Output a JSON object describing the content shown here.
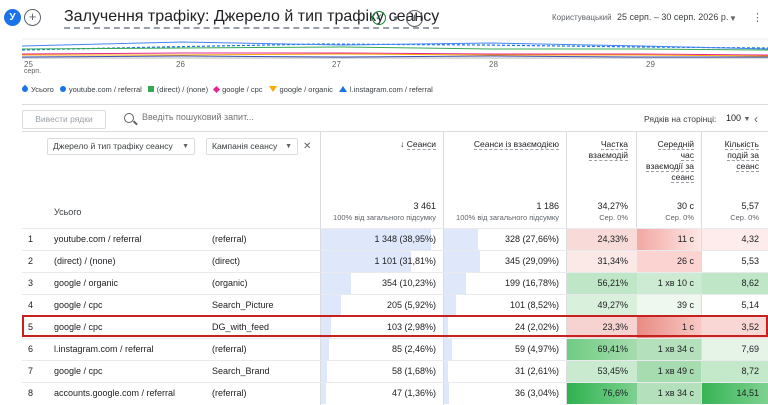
{
  "header": {
    "avatar_letter": "У",
    "title": "Залучення трафіку: Джерело й тип трафіку сеансу",
    "custom_label": "Користувацький",
    "date_range": "25 серп. – 30 серп. 2026 р."
  },
  "chart": {
    "x_ticks": [
      "25",
      "26",
      "27",
      "28",
      "29"
    ],
    "x_sub": "серп.",
    "legend": [
      {
        "label": "Усього",
        "color": "#1a73e8",
        "marker": "drop"
      },
      {
        "label": "youtube.com / referral",
        "color": "#1a73e8",
        "marker": "circle"
      },
      {
        "label": "(direct) / (none)",
        "color": "#34a853",
        "marker": "square"
      },
      {
        "label": "google / cpc",
        "color": "#e52592",
        "marker": "diamond"
      },
      {
        "label": "google / organic",
        "color": "#f9ab00",
        "marker": "triangle-down"
      },
      {
        "label": "l.instagram.com / referral",
        "color": "#1a73e8",
        "marker": "triangle-up"
      }
    ]
  },
  "toolbar": {
    "rows_button": "Вивести рядки",
    "search_placeholder": "Введіть пошуковий запит...",
    "rows_per_page_label": "Рядків на сторінці:",
    "rows_per_page_value": "100"
  },
  "table": {
    "dim1": "Джерело й тип трафіку сеансу",
    "dim2": "Кампанія сеансу",
    "metrics": [
      {
        "label": "Сеанси",
        "sorted": true
      },
      {
        "label": "Сеанси із взаємодією"
      },
      {
        "label": "Частка взаємодій"
      },
      {
        "label": "Середній час взаємодії за сеанс"
      },
      {
        "label": "Кількість подій за сеанс"
      }
    ],
    "totals": {
      "label": "Усього",
      "values": [
        "3 461",
        "1 186",
        "34,27%",
        "30 с",
        "5,57"
      ],
      "subs": [
        "100% від загального підсумку",
        "100% від загального підсумку",
        "Сер. 0%",
        "Сер. 0%",
        "Сер. 0%"
      ]
    },
    "rows": [
      {
        "n": "1",
        "source": "youtube.com / referral",
        "campaign": "(referral)",
        "sessions": "1 348 (38,95%)",
        "engaged": "328 (27,66%)",
        "rate": "24,33%",
        "time": "11 с",
        "events": "4,32"
      },
      {
        "n": "2",
        "source": "(direct) / (none)",
        "campaign": "(direct)",
        "sessions": "1 101 (31,81%)",
        "engaged": "345 (29,09%)",
        "rate": "31,34%",
        "time": "26 с",
        "events": "5,53"
      },
      {
        "n": "3",
        "source": "google / organic",
        "campaign": "(organic)",
        "sessions": "354 (10,23%)",
        "engaged": "199 (16,78%)",
        "rate": "56,21%",
        "time": "1 хв 10 с",
        "events": "8,62"
      },
      {
        "n": "4",
        "source": "google / cpc",
        "campaign": "Search_Picture",
        "sessions": "205 (5,92%)",
        "engaged": "101 (8,52%)",
        "rate": "49,27%",
        "time": "39 с",
        "events": "5,14"
      },
      {
        "n": "5",
        "source": "google / cpc",
        "campaign": "DG_with_feed",
        "sessions": "103 (2,98%)",
        "engaged": "24 (2,02%)",
        "rate": "23,3%",
        "time": "1 с",
        "events": "3,52"
      },
      {
        "n": "6",
        "source": "l.instagram.com / referral",
        "campaign": "(referral)",
        "sessions": "85 (2,46%)",
        "engaged": "59 (4,97%)",
        "rate": "69,41%",
        "time": "1 хв 34 с",
        "events": "7,69"
      },
      {
        "n": "7",
        "source": "google / cpc",
        "campaign": "Search_Brand",
        "sessions": "58 (1,68%)",
        "engaged": "31 (2,61%)",
        "rate": "53,45%",
        "time": "1 хв 49 с",
        "events": "8,72"
      },
      {
        "n": "8",
        "source": "accounts.google.com / referral",
        "campaign": "(referral)",
        "sessions": "47 (1,36%)",
        "engaged": "36 (3,04%)",
        "rate": "76,6%",
        "time": "1 хв 34 с",
        "events": "14,51"
      }
    ]
  }
}
